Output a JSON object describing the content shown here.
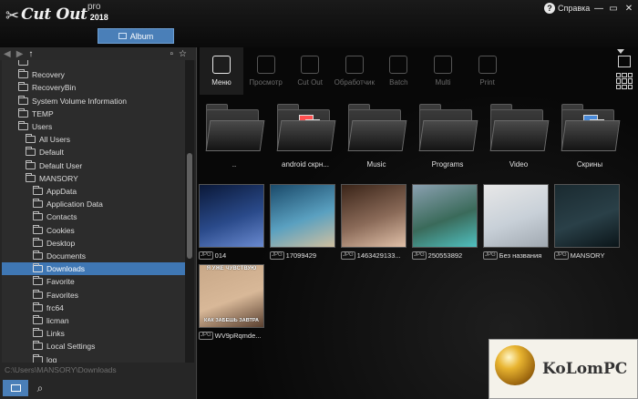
{
  "app": {
    "name": "Cut Out",
    "edition": "pro",
    "year": "2018",
    "album_tab": "Album",
    "help": "Справка"
  },
  "tree": {
    "items": [
      {
        "label": "",
        "indent": 0
      },
      {
        "label": "Recovery",
        "indent": 0
      },
      {
        "label": "RecoveryBin",
        "indent": 0
      },
      {
        "label": "System Volume Information",
        "indent": 0
      },
      {
        "label": "TEMP",
        "indent": 0
      },
      {
        "label": "Users",
        "indent": 0
      },
      {
        "label": "All Users",
        "indent": 1
      },
      {
        "label": "Default",
        "indent": 1
      },
      {
        "label": "Default User",
        "indent": 1
      },
      {
        "label": "MANSORY",
        "indent": 1
      },
      {
        "label": "AppData",
        "indent": 2
      },
      {
        "label": "Application Data",
        "indent": 2
      },
      {
        "label": "Contacts",
        "indent": 2
      },
      {
        "label": "Cookies",
        "indent": 2
      },
      {
        "label": "Desktop",
        "indent": 2
      },
      {
        "label": "Documents",
        "indent": 2
      },
      {
        "label": "Downloads",
        "indent": 2,
        "selected": true
      },
      {
        "label": "Favorite",
        "indent": 2
      },
      {
        "label": "Favorites",
        "indent": 2
      },
      {
        "label": "frc64",
        "indent": 2
      },
      {
        "label": "licman",
        "indent": 2
      },
      {
        "label": "Links",
        "indent": 2
      },
      {
        "label": "Local Settings",
        "indent": 2
      },
      {
        "label": "log",
        "indent": 2
      }
    ],
    "path": "C:\\Users\\MANSORY\\Downloads"
  },
  "toolbar": {
    "tools": [
      {
        "label": "Меню",
        "icon": "menu-icon",
        "active": true
      },
      {
        "label": "Просмотр",
        "icon": "eye-icon"
      },
      {
        "label": "Cut Out",
        "icon": "heart-cutout-icon"
      },
      {
        "label": "Обработчик",
        "icon": "magic-wand-icon"
      },
      {
        "label": "Batch",
        "icon": "batch-icon"
      },
      {
        "label": "Multi",
        "icon": "multi-icon"
      },
      {
        "label": "Print",
        "icon": "print-icon"
      }
    ]
  },
  "folders": [
    {
      "label": ".."
    },
    {
      "label": "android скрн..."
    },
    {
      "label": "Music"
    },
    {
      "label": "Programs"
    },
    {
      "label": "Video"
    },
    {
      "label": "Скрины"
    }
  ],
  "photos": [
    {
      "label": "014",
      "badge": "JPG",
      "colors": [
        "#0a1838",
        "#2a4a8a",
        "#6a8ad0"
      ]
    },
    {
      "label": "17099429",
      "badge": "JPG",
      "colors": [
        "#1a4a6a",
        "#5aa0c0",
        "#d0c0a0"
      ]
    },
    {
      "label": "1463429133...",
      "badge": "JPG",
      "colors": [
        "#3a2418",
        "#8a6a58",
        "#e0c0a8"
      ]
    },
    {
      "label": "250553892",
      "badge": "JPG",
      "colors": [
        "#8aa0b0",
        "#3a6a5a",
        "#50c0c0"
      ]
    },
    {
      "label": "Без названия",
      "badge": "JPG",
      "colors": [
        "#e8e8e8",
        "#c8d0d8",
        "#a0a8b0"
      ]
    },
    {
      "label": "MANSORY",
      "badge": "JPG",
      "colors": [
        "#1a2a30",
        "#2a4048",
        "#0a1418"
      ]
    },
    {
      "label": "WV9pRqmde...",
      "badge": "JPG",
      "colors": [
        "#c8a888",
        "#d8b898",
        "#5a4030"
      ]
    }
  ],
  "meme": {
    "top": "Я УЖЕ ЧУВСТВУЮ",
    "bottom": "КАК ЗАБЕШЬ ЗАВТРА"
  },
  "watermark": {
    "text": "KoLomPC"
  }
}
